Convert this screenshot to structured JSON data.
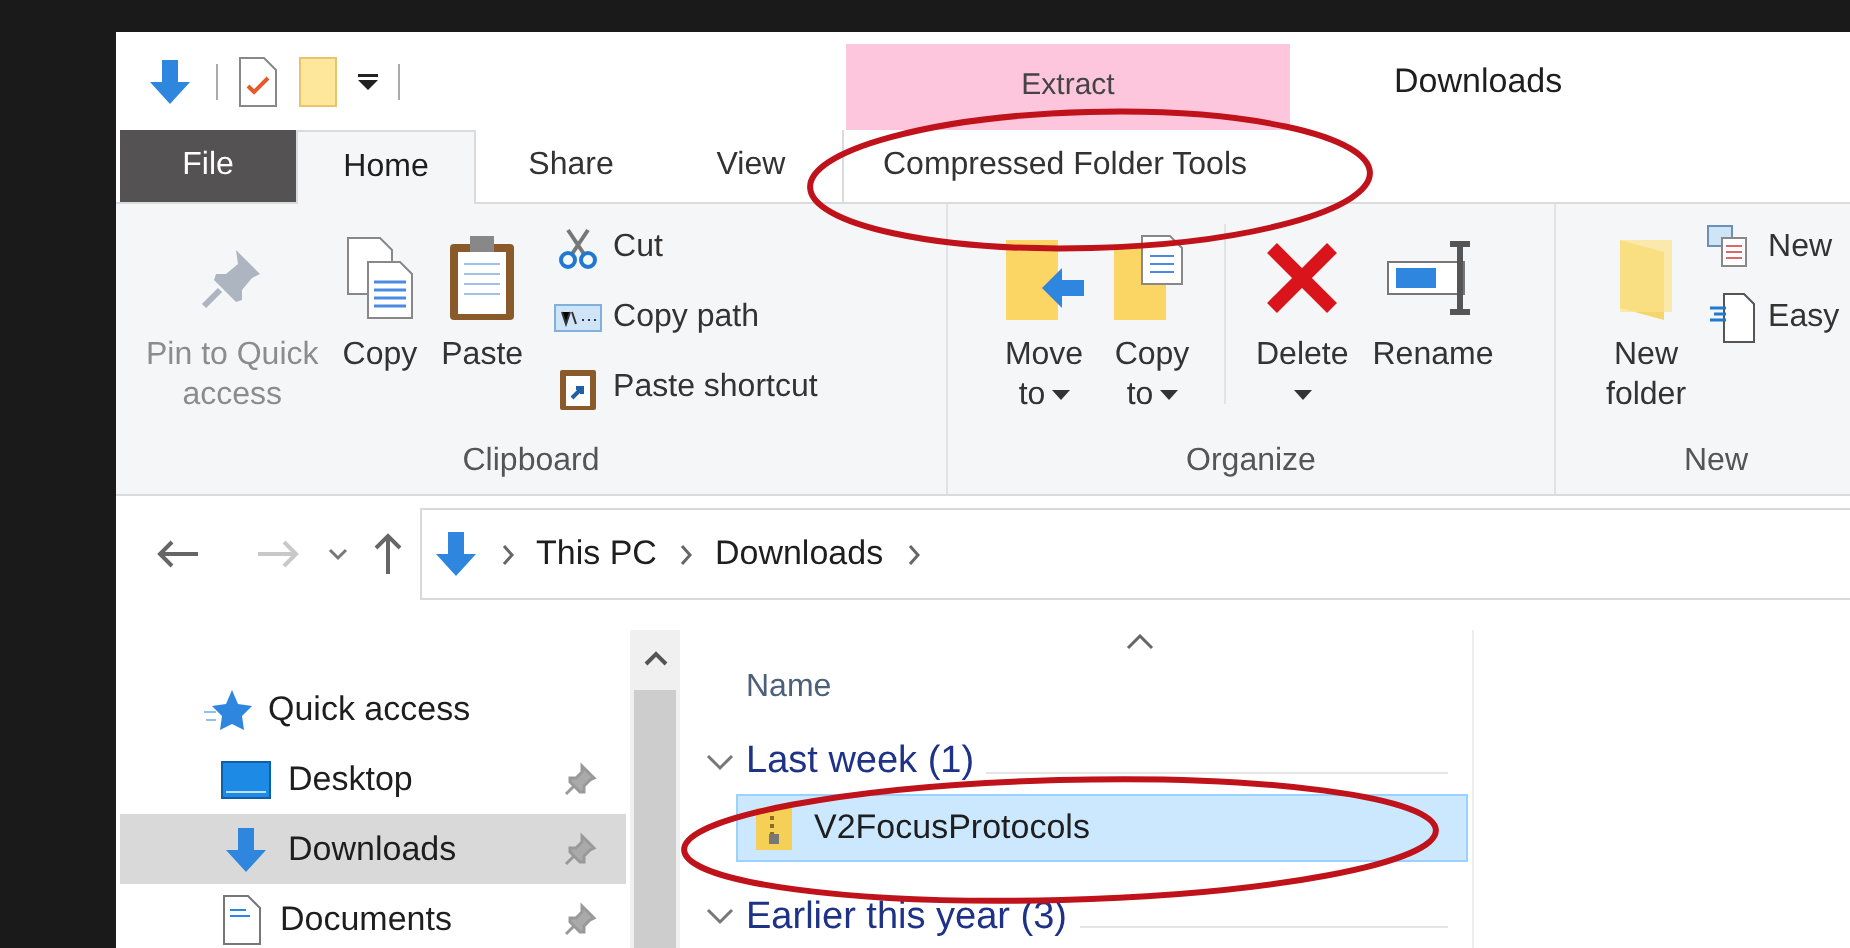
{
  "contextual_tab_group": {
    "label": "Extract"
  },
  "window": {
    "title": "Downloads"
  },
  "tabs": [
    {
      "label": "File",
      "kind": "file",
      "selected": false
    },
    {
      "label": "Home",
      "kind": "tab",
      "selected": true
    },
    {
      "label": "Share",
      "kind": "tab",
      "selected": false
    },
    {
      "label": "View",
      "kind": "tab",
      "selected": false
    },
    {
      "label": "Compressed Folder Tools",
      "kind": "tab",
      "selected": false
    }
  ],
  "ribbon": {
    "groups": [
      {
        "label": "Clipboard",
        "commands": [
          {
            "label": "Pin to Quick access",
            "kind": "large",
            "disabled": true,
            "dropdown": false
          },
          {
            "label": "Copy",
            "kind": "large",
            "disabled": false,
            "dropdown": false
          },
          {
            "label": "Paste",
            "kind": "large",
            "disabled": false,
            "dropdown": false
          },
          {
            "label": "Cut",
            "kind": "small",
            "disabled": false,
            "dropdown": false
          },
          {
            "label": "Copy path",
            "kind": "small",
            "disabled": false,
            "dropdown": false
          },
          {
            "label": "Paste shortcut",
            "kind": "small",
            "disabled": false,
            "dropdown": false
          }
        ]
      },
      {
        "label": "Organize",
        "commands": [
          {
            "label": "Move to",
            "kind": "large",
            "disabled": false,
            "dropdown": true
          },
          {
            "label": "Copy to",
            "kind": "large",
            "disabled": false,
            "dropdown": true
          },
          {
            "label": "Delete",
            "kind": "large",
            "disabled": false,
            "dropdown": true
          },
          {
            "label": "Rename",
            "kind": "large",
            "disabled": false,
            "dropdown": false
          }
        ]
      },
      {
        "label": "New",
        "commands": [
          {
            "label": "New folder",
            "kind": "large",
            "disabled": false,
            "dropdown": false
          },
          {
            "label": "New",
            "kind": "small",
            "disabled": false,
            "dropdown": false
          },
          {
            "label": "Easy",
            "kind": "small",
            "disabled": false,
            "dropdown": false
          }
        ]
      }
    ]
  },
  "navigation": {
    "back_disabled": false,
    "forward_disabled": true
  },
  "address_bar": {
    "breadcrumbs": [
      "This PC",
      "Downloads"
    ]
  },
  "navigation_pane": {
    "items": [
      {
        "label": "Quick access",
        "kind": "header",
        "selected": false,
        "pinned": false
      },
      {
        "label": "Desktop",
        "kind": "desktop",
        "selected": false,
        "pinned": true
      },
      {
        "label": "Downloads",
        "kind": "downloads",
        "selected": true,
        "pinned": true
      },
      {
        "label": "Documents",
        "kind": "documents",
        "selected": false,
        "pinned": true
      }
    ]
  },
  "file_list": {
    "columns": [
      {
        "label": "Name",
        "sorted": true
      }
    ],
    "groups": [
      {
        "label": "Last week (1)",
        "expanded": true,
        "items": [
          {
            "name": "V2FocusProtocols",
            "selected": true
          }
        ]
      },
      {
        "label": "Earlier this year (3)",
        "expanded": true
      }
    ]
  },
  "annotations": [
    {
      "kind": "ellipse"
    },
    {
      "kind": "ellipse"
    }
  ]
}
